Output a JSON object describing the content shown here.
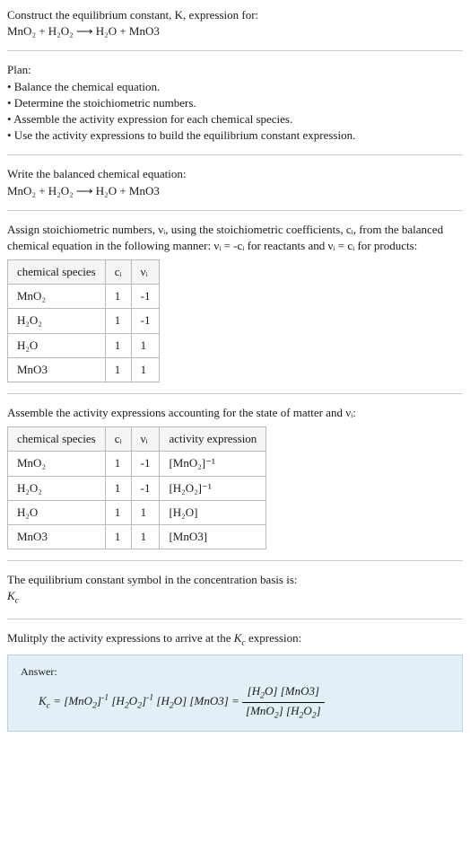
{
  "intro": {
    "line1": "Construct the equilibrium constant, K, expression for:",
    "equation": "MnO₂ + H₂O₂ ⟶ H₂O + MnO3"
  },
  "plan": {
    "heading": "Plan:",
    "items": [
      "• Balance the chemical equation.",
      "• Determine the stoichiometric numbers.",
      "• Assemble the activity expression for each chemical species.",
      "• Use the activity expressions to build the equilibrium constant expression."
    ]
  },
  "balanced": {
    "heading": "Write the balanced chemical equation:",
    "equation": "MnO₂ + H₂O₂ ⟶ H₂O + MnO3"
  },
  "stoich": {
    "text": "Assign stoichiometric numbers, νᵢ, using the stoichiometric coefficients, cᵢ, from the balanced chemical equation in the following manner: νᵢ = -cᵢ for reactants and νᵢ = cᵢ for products:",
    "headers": [
      "chemical species",
      "cᵢ",
      "νᵢ"
    ],
    "rows": [
      [
        "MnO₂",
        "1",
        "-1"
      ],
      [
        "H₂O₂",
        "1",
        "-1"
      ],
      [
        "H₂O",
        "1",
        "1"
      ],
      [
        "MnO3",
        "1",
        "1"
      ]
    ]
  },
  "activity": {
    "text": "Assemble the activity expressions accounting for the state of matter and νᵢ:",
    "headers": [
      "chemical species",
      "cᵢ",
      "νᵢ",
      "activity expression"
    ],
    "rows": [
      [
        "MnO₂",
        "1",
        "-1",
        "[MnO₂]⁻¹"
      ],
      [
        "H₂O₂",
        "1",
        "-1",
        "[H₂O₂]⁻¹"
      ],
      [
        "H₂O",
        "1",
        "1",
        "[H₂O]"
      ],
      [
        "MnO3",
        "1",
        "1",
        "[MnO3]"
      ]
    ]
  },
  "symbol": {
    "text": "The equilibrium constant symbol in the concentration basis is:",
    "kc": "K_c"
  },
  "multiply": {
    "text": "Mulitply the activity expressions to arrive at the K_c expression:"
  },
  "answer": {
    "label": "Answer:",
    "lhs": "K_c = [MnO₂]⁻¹ [H₂O₂]⁻¹ [H₂O] [MnO3] = ",
    "frac_num": "[H₂O] [MnO3]",
    "frac_den": "[MnO₂] [H₂O₂]"
  }
}
